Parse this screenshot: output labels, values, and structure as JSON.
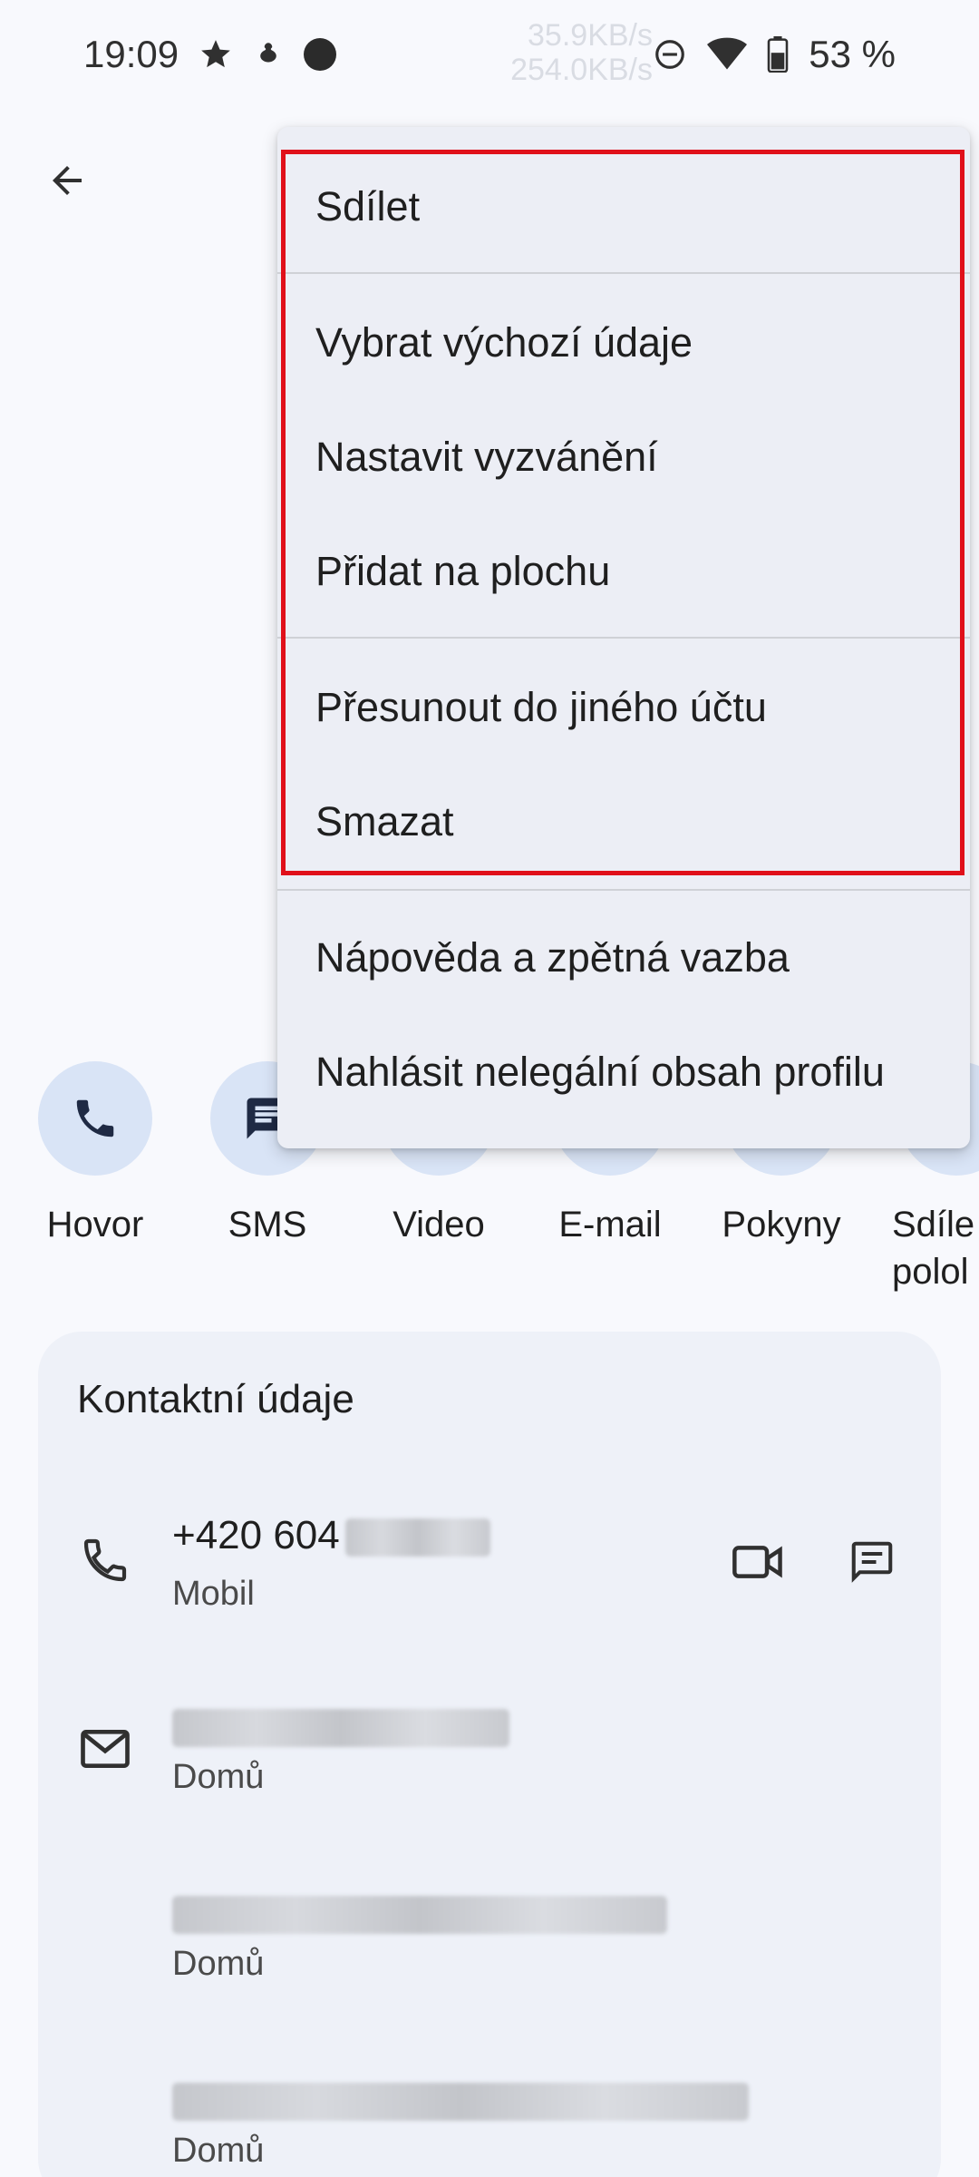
{
  "status_bar": {
    "time": "19:09",
    "net_up": "35.9KB/s",
    "net_down": "254.0KB/s",
    "battery": "53 %",
    "icons": [
      "star-icon",
      "bug-icon",
      "dot-icon",
      "dnd-icon",
      "wifi-icon",
      "battery-icon"
    ]
  },
  "menu": {
    "items": [
      "Sdílet",
      "Vybrat výchozí údaje",
      "Nastavit vyzvánění",
      "Přidat na plochu",
      "Přesunout do jiného účtu",
      "Smazat",
      "Nápověda a zpětná vazba",
      "Nahlásit nelegální obsah profilu"
    ],
    "highlight_color": "#e0101a"
  },
  "actions": [
    {
      "label": "Hovor",
      "icon": "phone-icon"
    },
    {
      "label": "SMS",
      "icon": "message-icon"
    },
    {
      "label": "Video",
      "icon": "video-icon"
    },
    {
      "label": "E-mail",
      "icon": "email-icon"
    },
    {
      "label": "Pokyny",
      "icon": "directions-icon"
    },
    {
      "label": "Sdíle polol",
      "icon": "location-share-icon"
    }
  ],
  "contact_info": {
    "title": "Kontaktní údaje",
    "phone": {
      "value": "+420 604",
      "type": "Mobil"
    },
    "emails": [
      {
        "type": "Domů"
      },
      {
        "type": "Domů"
      },
      {
        "type": "Domů"
      }
    ]
  },
  "colors": {
    "background": "#f8f9fd",
    "action_circle": "#d9e4f6",
    "card": "#eef1f8",
    "menu": "#eceef5"
  }
}
